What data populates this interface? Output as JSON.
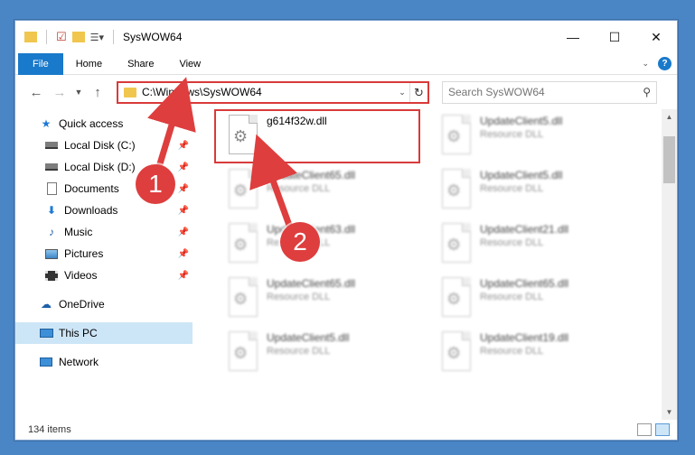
{
  "window": {
    "title": "SysWOW64"
  },
  "ribbon": {
    "tabs": [
      "File",
      "Home",
      "Share",
      "View"
    ]
  },
  "address": {
    "path": "C:\\Windows\\SysWOW64"
  },
  "search": {
    "placeholder": "Search SysWOW64"
  },
  "sidebar": {
    "items": [
      {
        "label": "Quick access",
        "icon": "star-icon"
      },
      {
        "label": "Local Disk (C:)",
        "icon": "drive-icon",
        "pinned": true
      },
      {
        "label": "Local Disk (D:)",
        "icon": "drive-icon",
        "pinned": true
      },
      {
        "label": "Documents",
        "icon": "documents-icon",
        "pinned": true
      },
      {
        "label": "Downloads",
        "icon": "download-icon",
        "pinned": true
      },
      {
        "label": "Music",
        "icon": "music-icon",
        "pinned": true
      },
      {
        "label": "Pictures",
        "icon": "pictures-icon",
        "pinned": true
      },
      {
        "label": "Videos",
        "icon": "videos-icon",
        "pinned": true
      },
      {
        "label": "OneDrive",
        "icon": "cloud-icon"
      },
      {
        "label": "This PC",
        "icon": "computer-icon",
        "selected": true
      },
      {
        "label": "Network",
        "icon": "network-icon"
      }
    ]
  },
  "files": [
    {
      "name": "g614f32w.dll",
      "type": ""
    },
    {
      "name": "UpdateClient5.dll",
      "type": "Resource DLL"
    },
    {
      "name": "UpdateClient65.dll",
      "type": "Resource DLL"
    },
    {
      "name": "UpdateClient5.dll",
      "type": "Resource DLL"
    },
    {
      "name": "UpdateClient63.dll",
      "type": "Resource DLL"
    },
    {
      "name": "UpdateClient21.dll",
      "type": "Resource DLL"
    },
    {
      "name": "UpdateClient65.dll",
      "type": "Resource DLL"
    },
    {
      "name": "UpdateClient65.dll",
      "type": "Resource DLL"
    },
    {
      "name": "UpdateClient5.dll",
      "type": "Resource DLL"
    },
    {
      "name": "UpdateClient19.dll",
      "type": "Resource DLL"
    }
  ],
  "status": {
    "item_count": "134 items"
  },
  "annotations": {
    "step1": "1",
    "step2": "2",
    "color": "#de3e3e"
  }
}
